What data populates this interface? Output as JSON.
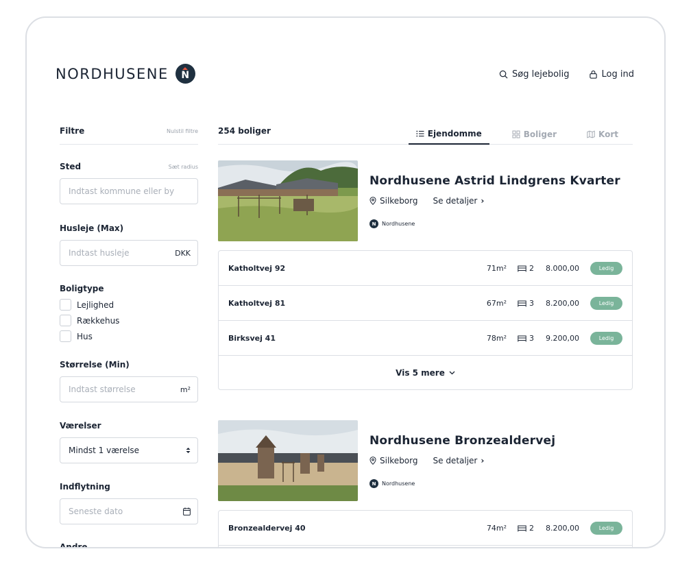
{
  "header": {
    "logo_text": "NORDHUSENE",
    "logo_mark": "N",
    "nav": [
      {
        "label": "Søg lejebolig",
        "icon": "search-icon"
      },
      {
        "label": "Log ind",
        "icon": "lock-icon"
      }
    ]
  },
  "filters": {
    "title": "Filtre",
    "reset": "Nulstil filtre",
    "location": {
      "label": "Sted",
      "link": "Sæt radius",
      "placeholder": "Indtast kommune eller by"
    },
    "rent": {
      "label": "Husleje (Max)",
      "placeholder": "Indtast husleje",
      "suffix": "DKK"
    },
    "type": {
      "label": "Boligtype",
      "options": [
        "Lejlighed",
        "Rækkehus",
        "Hus"
      ]
    },
    "size": {
      "label": "Størrelse (Min)",
      "placeholder": "Indtast størrelse",
      "suffix": "m²"
    },
    "rooms": {
      "label": "Værelser",
      "value": "Mindst 1 værelse"
    },
    "movein": {
      "label": "Indflytning",
      "placeholder": "Seneste dato"
    },
    "other": {
      "label": "Andre"
    }
  },
  "results": {
    "count": "254 boliger",
    "tabs": [
      {
        "label": "Ejendomme",
        "icon": "list-icon",
        "active": true
      },
      {
        "label": "Boliger",
        "icon": "grid-icon",
        "active": false
      },
      {
        "label": "Kort",
        "icon": "map-icon",
        "active": false
      }
    ]
  },
  "properties": [
    {
      "title": "Nordhusene Astrid Lindgrens Kvarter",
      "city": "Silkeborg",
      "details": "Se detaljer",
      "brand": "Nordhusene",
      "units": [
        {
          "address": "Katholtvej 92",
          "area": "71m²",
          "rooms": "2",
          "price": "8.000,00",
          "status": "Ledig"
        },
        {
          "address": "Katholtvej 81",
          "area": "67m²",
          "rooms": "3",
          "price": "8.200,00",
          "status": "Ledig"
        },
        {
          "address": "Birksvej 41",
          "area": "78m²",
          "rooms": "3",
          "price": "9.200,00",
          "status": "Ledig"
        }
      ],
      "more": "Vis 5 mere"
    },
    {
      "title": "Nordhusene Bronzealdervej",
      "city": "Silkeborg",
      "details": "Se detaljer",
      "brand": "Nordhusene",
      "units": [
        {
          "address": "Bronzealdervej 40",
          "area": "74m²",
          "rooms": "2",
          "price": "8.200,00",
          "status": "Ledig"
        }
      ]
    }
  ],
  "colors": {
    "brand_dark": "#1f3040",
    "accent_red": "#e4563f",
    "status_green": "#7ab49a"
  }
}
